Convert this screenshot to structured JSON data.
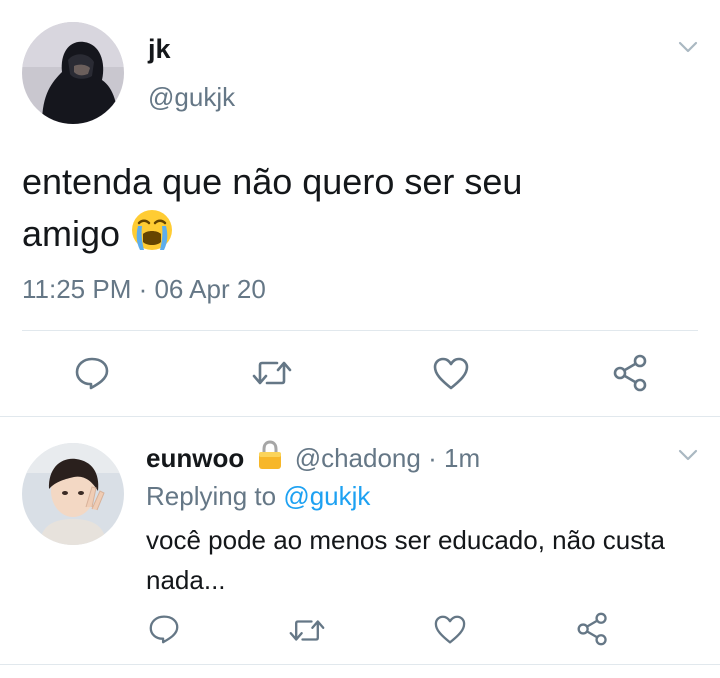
{
  "main_tweet": {
    "display_name": "jk",
    "handle": "@gukjk",
    "text_line1": "entenda que não quero ser seu",
    "text_line2": "amigo",
    "emoji_icon": "loudly-crying-face-icon",
    "timestamp": "11:25 PM · 06 Apr 20",
    "actions": [
      "reply-icon",
      "retweet-icon",
      "like-icon",
      "share-icon"
    ]
  },
  "reply_tweet": {
    "display_name": "eunwoo",
    "lock_icon": "lock-icon",
    "handle": "@chadong",
    "separator": "·",
    "time": "1m",
    "replying_prefix": "Replying to",
    "replying_handle": "@gukjk",
    "text_line1": "você pode ao menos ser educado, não custa",
    "text_line2": "nada...",
    "actions": [
      "reply-icon",
      "retweet-icon",
      "like-icon",
      "share-icon"
    ]
  },
  "colors": {
    "text": "#14171a",
    "muted": "#657786",
    "link": "#1da1f2",
    "divider": "#e1e8ed"
  }
}
